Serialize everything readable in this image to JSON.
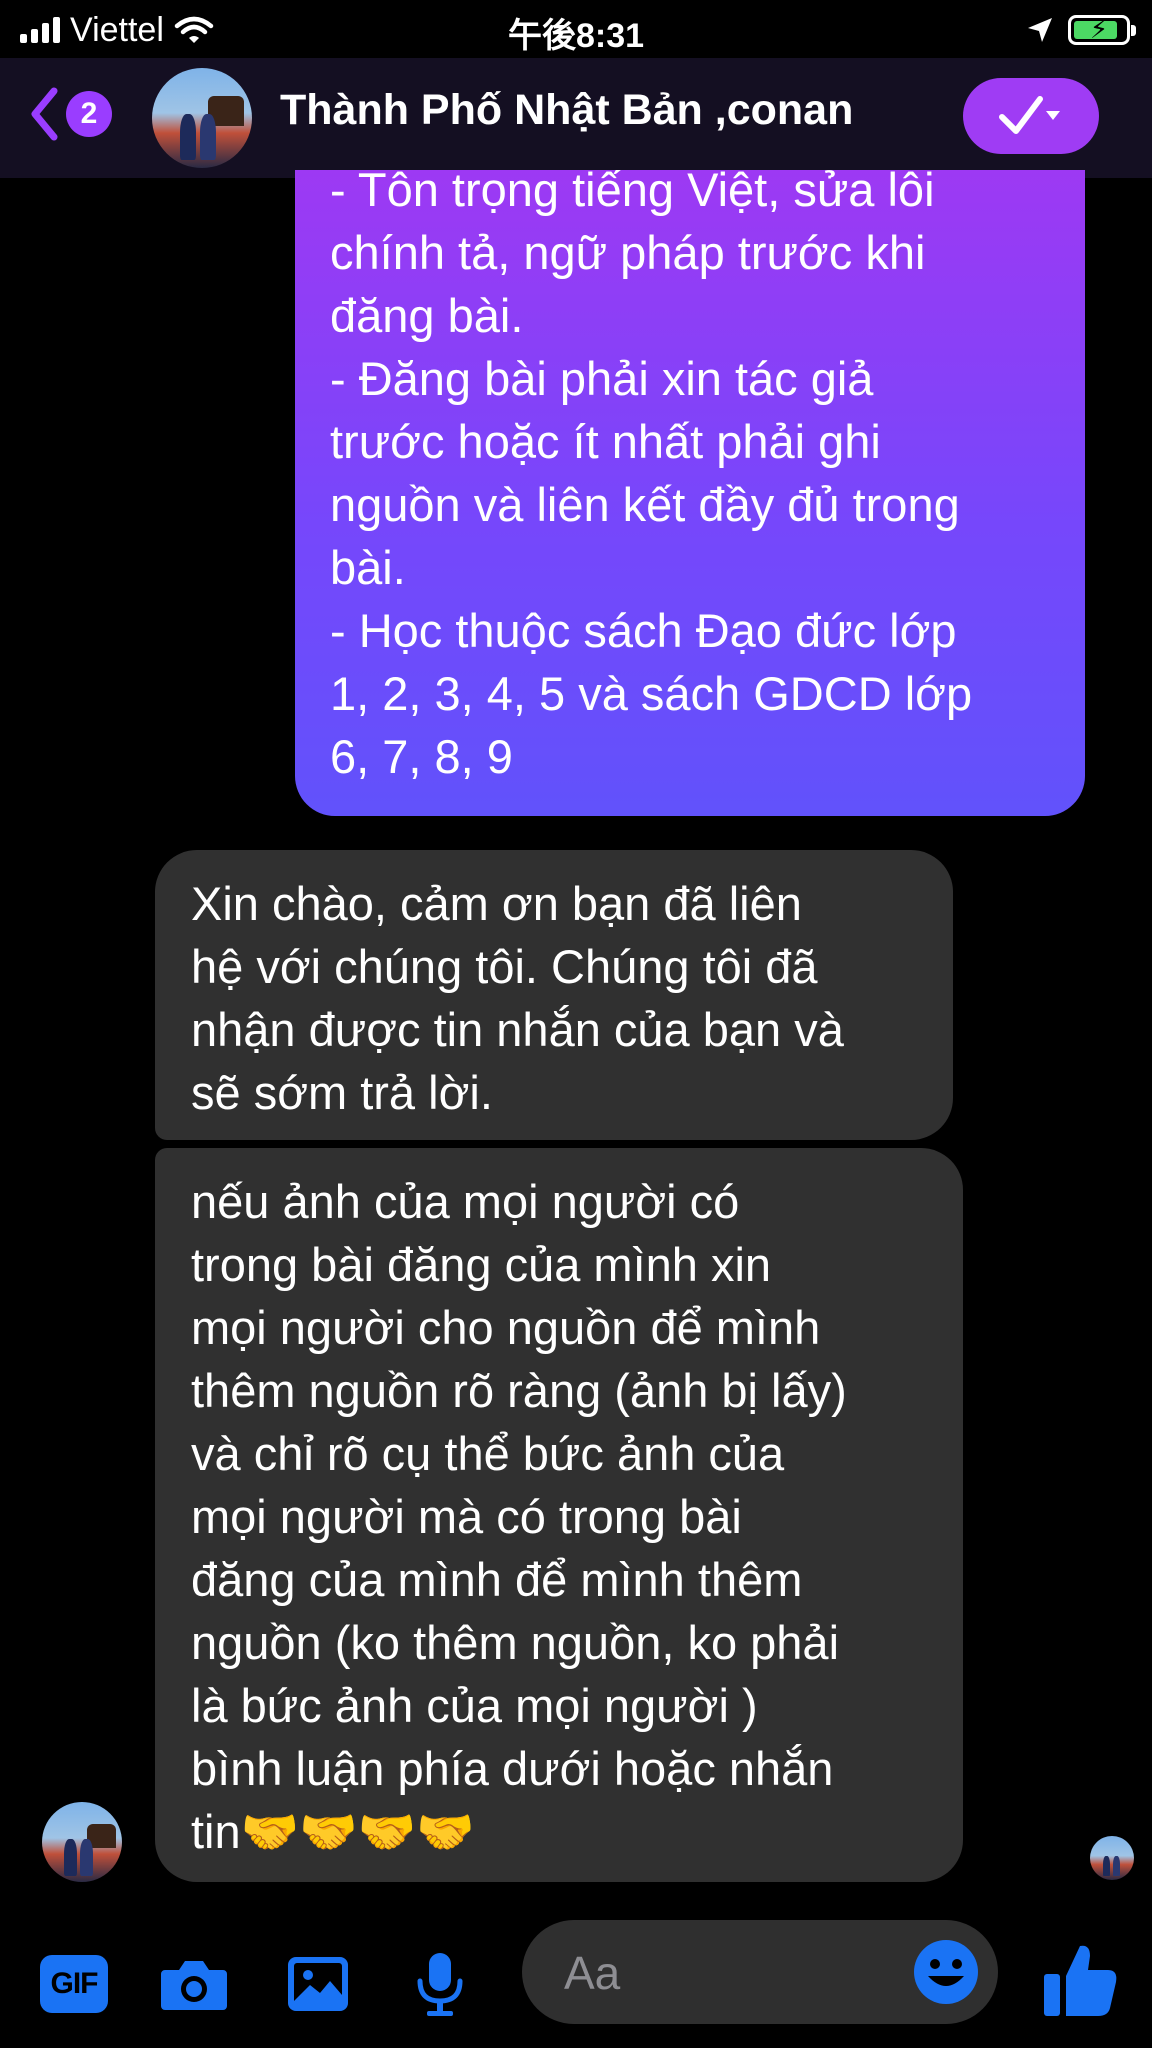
{
  "status_bar": {
    "carrier": "Viettel",
    "time": "午後8:31",
    "battery_level": 0.85
  },
  "header": {
    "back_count": "2",
    "title": "Thành Phố Nhật Bản ,conan"
  },
  "messages": [
    {
      "sender": "me",
      "text": "- Tôn trọng tiếng Việt, sửa lỗi\nchính tả, ngữ pháp trước khi\nđăng bài.\n- Đăng bài phải xin tác giả\ntrước hoặc ít nhất phải ghi\nnguồn và liên kết đầy đủ trong\nbài.\n- Học thuộc sách Đạo đức lớp\n1, 2, 3, 4, 5 và sách GDCD lớp\n6, 7, 8, 9"
    },
    {
      "sender": "page",
      "text": "Xin chào, cảm ơn bạn đã liên\nhệ với chúng tôi. Chúng tôi đã\nnhận được tin nhắn của bạn và\nsẽ sớm trả lời."
    },
    {
      "sender": "page",
      "text": "nếu ảnh của mọi người có\ntrong bài đăng của mình xin\nmọi người cho nguồn để mình\nthêm nguồn rõ ràng (ảnh bị lấy)\nvà chỉ rõ cụ thể bức ảnh của\nmọi người mà có trong bài\nđăng của mình để mình thêm\nnguồn (ko thêm nguồn, ko phải\nlà bức ảnh của mọi người )\nbình luận phía dưới hoặc nhắn\ntin🤝🤝🤝🤝"
    }
  ],
  "composer": {
    "gif_label": "GIF",
    "placeholder": "Aa"
  },
  "colors": {
    "accent": "#9f3cf4",
    "sent_bubble_top": "#9d39f3",
    "sent_bubble_bottom": "#6152fb",
    "received_bubble": "#303030",
    "toolbar_icon": "#1a73f4"
  },
  "icons": {
    "back": "chevron-left-icon",
    "check": "check-dropdown-icon",
    "camera": "camera-icon",
    "photo": "photo-icon",
    "mic": "microphone-icon",
    "emoji": "smile-icon",
    "like": "thumbs-up-icon"
  }
}
